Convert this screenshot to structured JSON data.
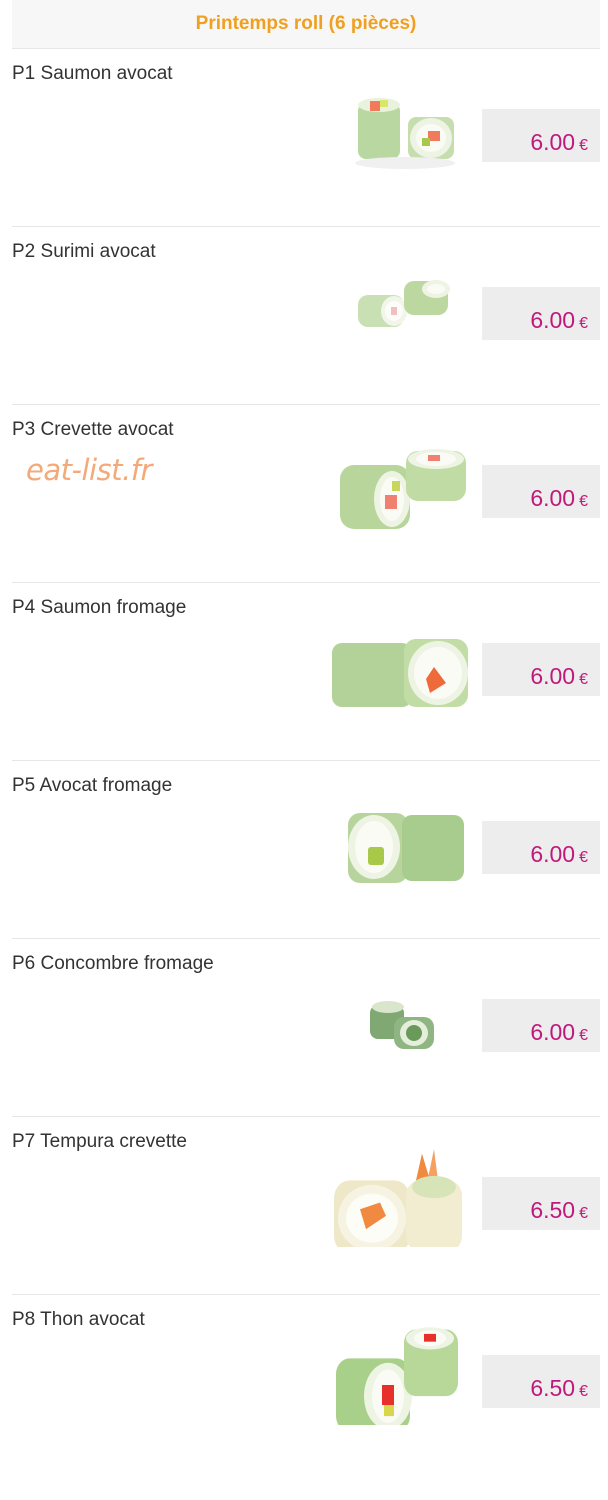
{
  "header": {
    "title": "Printemps roll (6 pièces)",
    "title_color": "#f0a020"
  },
  "price_color": "#c0197c",
  "currency": "€",
  "items": [
    {
      "name": "P1 Saumon avocat",
      "price": "6.00",
      "image_icon": "salmon-avocado-roll-image"
    },
    {
      "name": "P2 Surimi avocat",
      "price": "6.00",
      "image_icon": "surimi-avocado-roll-image"
    },
    {
      "name": "P3 Crevette avocat",
      "price": "6.00",
      "image_icon": "shrimp-avocado-roll-image"
    },
    {
      "name": "P4 Saumon fromage",
      "price": "6.00",
      "image_icon": "salmon-cheese-roll-image"
    },
    {
      "name": "P5 Avocat fromage",
      "price": "6.00",
      "image_icon": "avocado-cheese-roll-image"
    },
    {
      "name": "P6 Concombre fromage",
      "price": "6.00",
      "image_icon": "cucumber-cheese-roll-image"
    },
    {
      "name": "P7 Tempura crevette",
      "price": "6.50",
      "image_icon": "tempura-shrimp-roll-image"
    },
    {
      "name": "P8 Thon avocat",
      "price": "6.50",
      "image_icon": "tuna-avocado-roll-image"
    }
  ],
  "watermark": "eat-list.fr"
}
